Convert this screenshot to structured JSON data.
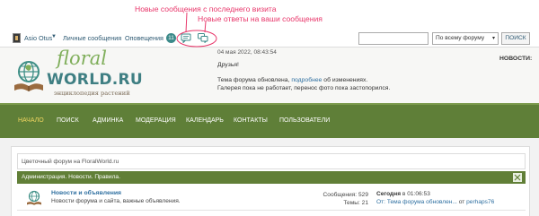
{
  "annotations": {
    "new_messages": "Новые сообщения с последнего визита",
    "new_replies": "Новые ответы на ваши сообщения"
  },
  "topbar": {
    "username": "Asio Otus",
    "private_messages": "Личные сообщения",
    "notifications": "Оповещения",
    "notifications_count": "11",
    "search_placeholder": "",
    "search_scope": "По всему форуму",
    "search_button": "ПОИСК"
  },
  "logo": {
    "floral": "floral",
    "world": "WORLD.RU",
    "subtitle": "энциклопедия растений"
  },
  "notice": {
    "date": "04 мая 2022, 08:43:54",
    "greeting": "Друзья!",
    "line1_before": "Тема форума обновлена,",
    "line1_link": "подробнее",
    "line1_after": "об изменениях.",
    "line2": "Галерея пока не работает, перенос фото пока застопорился."
  },
  "news_label": "НОВОСТИ:",
  "nav": [
    "Начало",
    "Поиск",
    "Админка",
    "Модерация",
    "Календарь",
    "Контакты",
    "Пользователи"
  ],
  "breadcrumb": "Цветочный форум на FloralWorld.ru",
  "category": {
    "title": "Администрация. Новости. Правила."
  },
  "forum": {
    "name": "Новости и объявления",
    "description": "Новости форума и сайта, важные объявления.",
    "posts_label": "Сообщения:",
    "posts": "529",
    "topics_label": "Темы:",
    "topics": "21",
    "last_when": "Сегодня",
    "last_time": "в 01:06:53",
    "last_from": "От:",
    "last_topic": "Тема форума обновлен...",
    "last_by": "от",
    "last_user": "perhaps76"
  },
  "colors": {
    "annotation": "#e8366a",
    "nav_bg": "#5f7f38",
    "nav_active": "#f0d660",
    "link": "#2e6fa0",
    "category_bg": "#617f37"
  }
}
